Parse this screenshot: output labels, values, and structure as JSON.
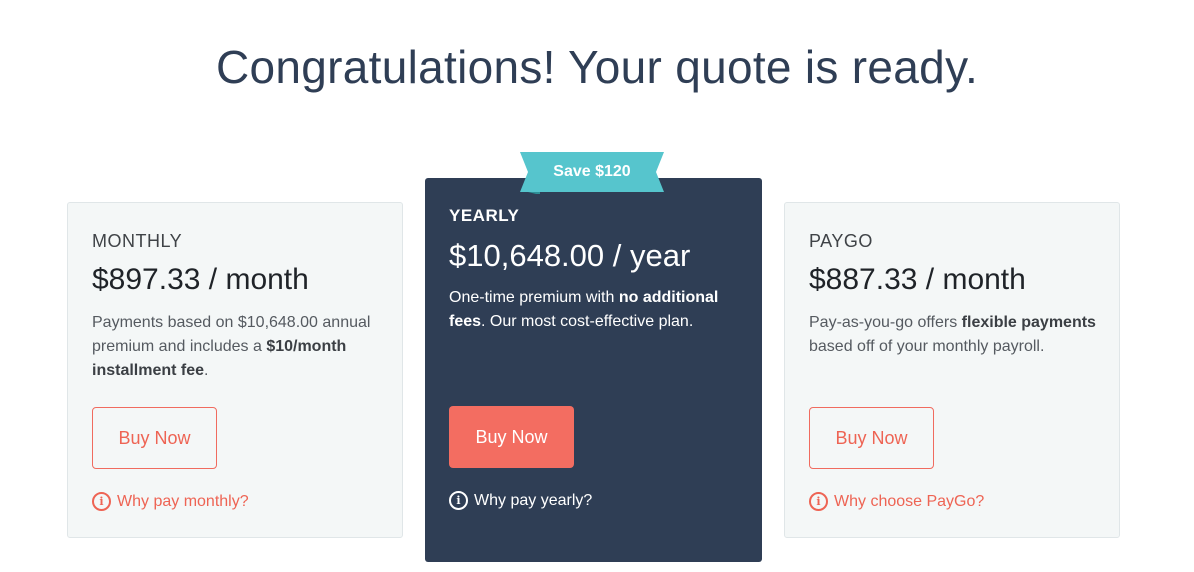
{
  "page": {
    "title": "Congratulations! Your quote is ready."
  },
  "plans": {
    "monthly": {
      "name": "MONTHLY",
      "price": "$897.33 / month",
      "desc_part1": "Payments based on $10,648.00 annual premium and includes a ",
      "desc_bold": "$10/month installment fee",
      "desc_part2": ".",
      "button_label": "Buy Now",
      "why_label": "Why pay monthly?"
    },
    "yearly": {
      "badge": "Save $120",
      "name": "YEARLY",
      "price": "$10,648.00 / year",
      "desc_part1": "One-time premium with ",
      "desc_bold": "no additional fees",
      "desc_part2": ". Our most cost-effective plan.",
      "button_label": "Buy Now",
      "why_label": "Why pay yearly?"
    },
    "paygo": {
      "name": "PAYGO",
      "price": "$887.33 / month",
      "desc_part1": "Pay-as-you-go offers ",
      "desc_bold": "flexible payments",
      "desc_part2": " based off of your monthly payroll.",
      "button_label": "Buy Now",
      "why_label": "Why choose PayGo?"
    }
  },
  "icons": {
    "info": "info-circle-icon"
  },
  "colors": {
    "heading": "#2f3e55",
    "dark_card": "#2f3e55",
    "accent": "#f36d61",
    "badge": "#56c5cd",
    "light_card": "#f4f7f7"
  }
}
